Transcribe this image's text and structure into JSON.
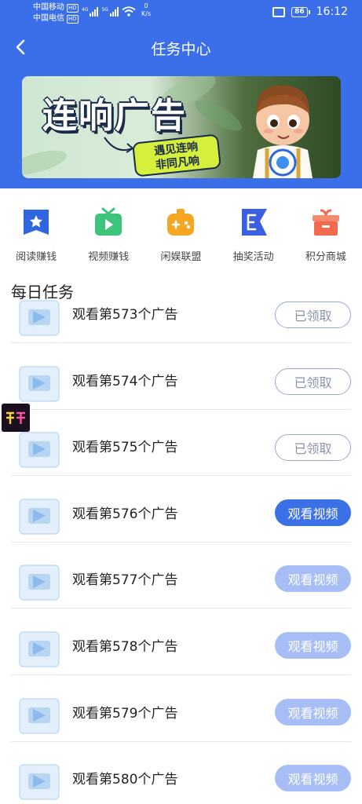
{
  "status_bar": {
    "carrier_1": "中国移动",
    "carrier_2": "中国电信",
    "hd": "HD",
    "net_1": "4G",
    "net_2": "5G",
    "speed_value": "0",
    "speed_unit": "K/s",
    "battery": "86",
    "time": "16:12"
  },
  "nav": {
    "title": "任务中心"
  },
  "banner": {
    "title": "连响广告",
    "subtitle_line1": "遇见连响",
    "subtitle_line2": "非同凡响"
  },
  "shortcuts": [
    {
      "label": "阅读赚钱",
      "icon": "star-doc-icon",
      "color": "#2f66e0"
    },
    {
      "label": "视频赚钱",
      "icon": "tv-play-icon",
      "color": "#3cc47a"
    },
    {
      "label": "闲娱联盟",
      "icon": "gamepad-icon",
      "color": "#f5a623"
    },
    {
      "label": "抽奖活动",
      "icon": "flag-icon",
      "color": "#3a5fe0"
    },
    {
      "label": "积分商城",
      "icon": "gift-box-icon",
      "color": "#f26b4e"
    }
  ],
  "section_title": "每日任务",
  "tasks": [
    {
      "label": "观看第573个广告",
      "button": "已领取",
      "state": "claimed"
    },
    {
      "label": "观看第574个广告",
      "button": "已领取",
      "state": "claimed"
    },
    {
      "label": "观看第575个广告",
      "button": "已领取",
      "state": "claimed"
    },
    {
      "label": "观看第576个广告",
      "button": "观看视频",
      "state": "active"
    },
    {
      "label": "观看第577个广告",
      "button": "观看视频",
      "state": "disabled"
    },
    {
      "label": "观看第578个广告",
      "button": "观看视频",
      "state": "disabled"
    },
    {
      "label": "观看第579个广告",
      "button": "观看视频",
      "state": "disabled"
    },
    {
      "label": "观看第580个广告",
      "button": "观看视频",
      "state": "disabled"
    }
  ],
  "colors": {
    "header_blue": "#3b6fea",
    "button_active": "#3c70e6",
    "button_disabled": "#a6bef5",
    "button_claimed_border": "#9aa9d3"
  }
}
